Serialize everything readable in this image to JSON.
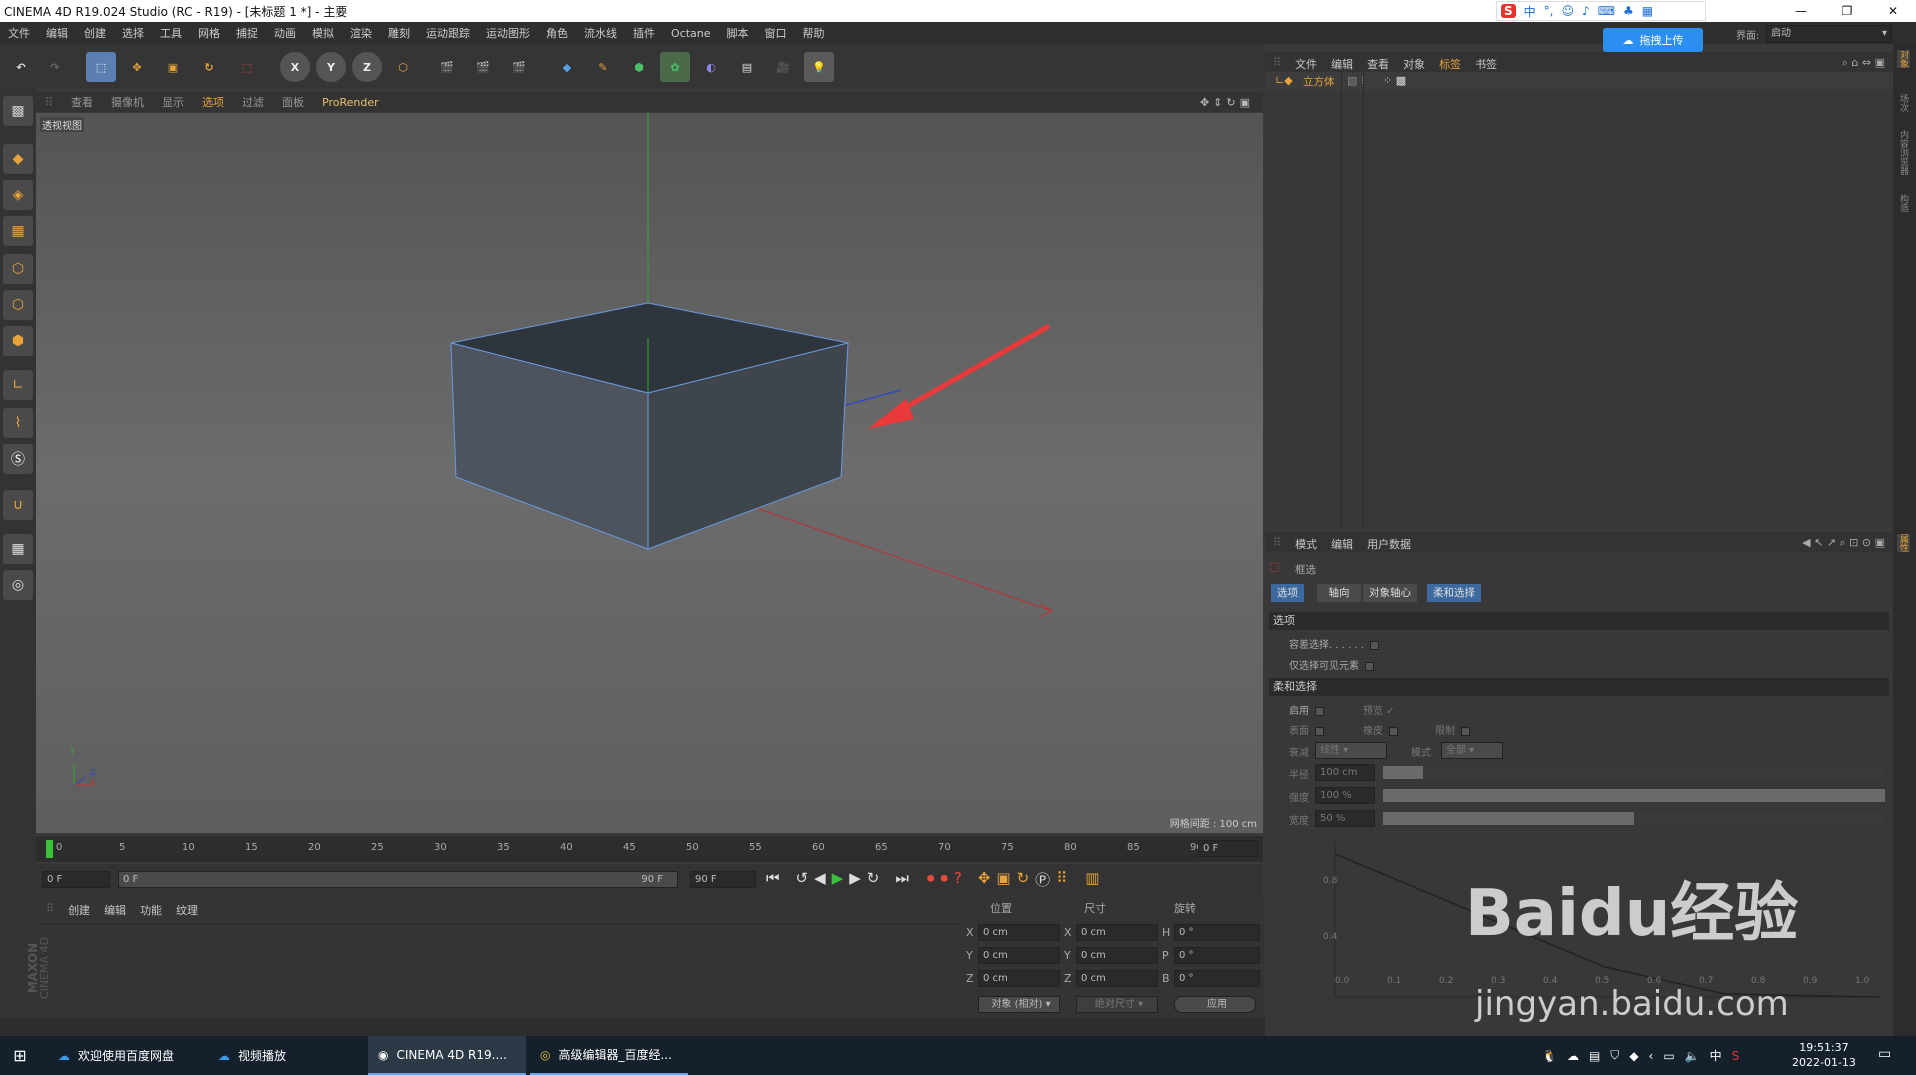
{
  "window": {
    "title": "CINEMA 4D R19.024 Studio (RC - R19) - [未标题 1 *] - 主要"
  },
  "menu": [
    "文件",
    "编辑",
    "创建",
    "选择",
    "工具",
    "网格",
    "捕捉",
    "动画",
    "模拟",
    "渲染",
    "雕刻",
    "运动跟踪",
    "运动图形",
    "角色",
    "流水线",
    "插件",
    "Octane",
    "脚本",
    "窗口",
    "帮助"
  ],
  "ime": {
    "lang": "中",
    "upload": "拖拽上传",
    "layout_label": "界面:",
    "layout_value": "启动"
  },
  "toolbar": {
    "x": "X",
    "y": "Y",
    "z": "Z"
  },
  "viewport": {
    "menu": [
      "查看",
      "摄像机",
      "显示",
      "选项",
      "过滤",
      "面板",
      "ProRender"
    ],
    "label": "透视视图",
    "grid_spacing": "网格间距 : 100 cm",
    "axis_y": "Y",
    "axis_z": "Z",
    "axis_x": "X"
  },
  "timeline": {
    "ticks": [
      "0",
      "5",
      "10",
      "15",
      "20",
      "25",
      "30",
      "35",
      "40",
      "45",
      "50",
      "55",
      "60",
      "65",
      "70",
      "75",
      "80",
      "85",
      "90"
    ],
    "frame_right": "0 F"
  },
  "transport": {
    "start": "0 F",
    "range_start": "0 F",
    "range_end": "90 F",
    "end": "90 F"
  },
  "material": {
    "menu": [
      "创建",
      "编辑",
      "功能",
      "纹理"
    ],
    "logo1": "MAXON",
    "logo2": "CINEMA 4D"
  },
  "coords": {
    "headers": [
      "位置",
      "尺寸",
      "旋转"
    ],
    "rows": [
      {
        "a": "X",
        "pos": "0 cm",
        "b": "X",
        "size": "0 cm",
        "c": "H",
        "rot": "0 °"
      },
      {
        "a": "Y",
        "pos": "0 cm",
        "b": "Y",
        "size": "0 cm",
        "c": "P",
        "rot": "0 °"
      },
      {
        "a": "Z",
        "pos": "0 cm",
        "b": "Z",
        "size": "0 cm",
        "c": "B",
        "rot": "0 °"
      }
    ],
    "mode": "对象 (相对)",
    "size_mode": "绝对尺寸",
    "apply": "应用"
  },
  "objects": {
    "menu": [
      "文件",
      "编辑",
      "查看",
      "对象",
      "标签",
      "书签"
    ],
    "item": "立方体"
  },
  "attributes": {
    "menu": [
      "模式",
      "编辑",
      "用户数据"
    ],
    "title": "框选",
    "tabs": [
      "选项",
      "轴向",
      "对象轴心",
      "柔和选择"
    ],
    "section_options": "选项",
    "tolerant": "容差选择. . . . . .",
    "visible_only": "仅选择可见元素",
    "section_soft": "柔和选择",
    "enable": "启用",
    "preview": "预览",
    "surface": "表面",
    "rubber": "橡皮",
    "restrict": "限制",
    "falloff_label": "衰减",
    "falloff_value": "线性",
    "mode_label": "模式",
    "mode_value": "全部",
    "radius_label": "半径",
    "radius_value": "100 cm",
    "strength_label": "强度",
    "strength_value": "100 %",
    "width_label": "宽度",
    "width_value": "50 %",
    "graph_y": [
      "0.8",
      "0.4"
    ],
    "graph_x": [
      "0.0",
      "0.1",
      "0.2",
      "0.3",
      "0.4",
      "0.5",
      "0.6",
      "0.7",
      "0.8",
      "0.9",
      "1.0"
    ]
  },
  "right_strip": [
    "对象",
    "场次",
    "内容浏览器",
    "构造",
    "属性"
  ],
  "watermark": {
    "brand": "Baidu经验",
    "url": "jingyan.baidu.com"
  },
  "taskbar": {
    "items": [
      "欢迎使用百度网盘",
      "视频播放",
      "CINEMA 4D R19....",
      "高级编辑器_百度经..."
    ],
    "time": "19:51:37",
    "date": "2022-01-13",
    "ime": "中"
  },
  "colors": {
    "accent": "#e8a23a",
    "selection_tab": "#3d6a9e",
    "arrow": "#e83a3a"
  }
}
